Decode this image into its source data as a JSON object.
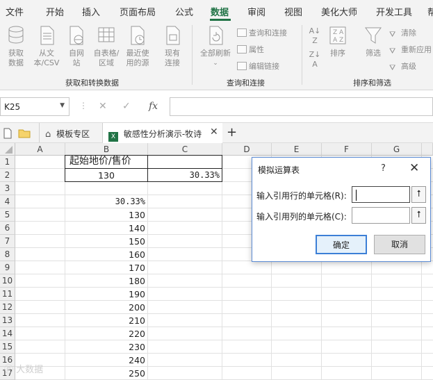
{
  "menu": {
    "tabs": [
      "文件",
      "开始",
      "插入",
      "页面布局",
      "公式",
      "数据",
      "审阅",
      "视图",
      "美化大师",
      "开发工具"
    ],
    "active": "数据",
    "accent": "#217346"
  },
  "ribbon": {
    "get_data": {
      "buttons": [
        "获取数据",
        "从文本/CSV",
        "自网站",
        "自表格/区域",
        "最近使用的源",
        "现有连接"
      ],
      "label": "获取和转换数据"
    },
    "query": {
      "refresh": "全部刷新",
      "small": [
        "查询和连接",
        "属性",
        "编辑链接"
      ],
      "label": "查询和连接"
    },
    "sort_filter": {
      "sort": "排序",
      "filter": "筛选",
      "small": [
        "清除",
        "重新应用",
        "高级"
      ],
      "label": "排序和筛选"
    }
  },
  "formula_bar": {
    "name_box": "K25",
    "fx": "fx"
  },
  "workbook_tabs": {
    "tab1": "模板专区",
    "tab2": "敏感性分析演示-牧诗"
  },
  "grid": {
    "columns": [
      "A",
      "B",
      "C",
      "D",
      "E",
      "F",
      "G"
    ],
    "rows": [
      "1",
      "2",
      "3",
      "4",
      "5",
      "6",
      "7",
      "8",
      "9",
      "10",
      "11",
      "12",
      "13",
      "14",
      "15",
      "16",
      "17"
    ],
    "b1": "起始地价/售价",
    "b2": "130",
    "c2": "30.33%",
    "b_col_values": [
      "30.33%",
      "130",
      "140",
      "150",
      "160",
      "170",
      "180",
      "190",
      "200",
      "210",
      "220",
      "230",
      "240",
      "250"
    ]
  },
  "dialog": {
    "title": "模拟运算表",
    "help": "?",
    "close": "✕",
    "row_input_label": "输入引用行的单元格(R):",
    "col_input_label": "输入引用列的单元格(C):",
    "ok": "确定",
    "cancel": "取消"
  },
  "watermark": "大数据"
}
